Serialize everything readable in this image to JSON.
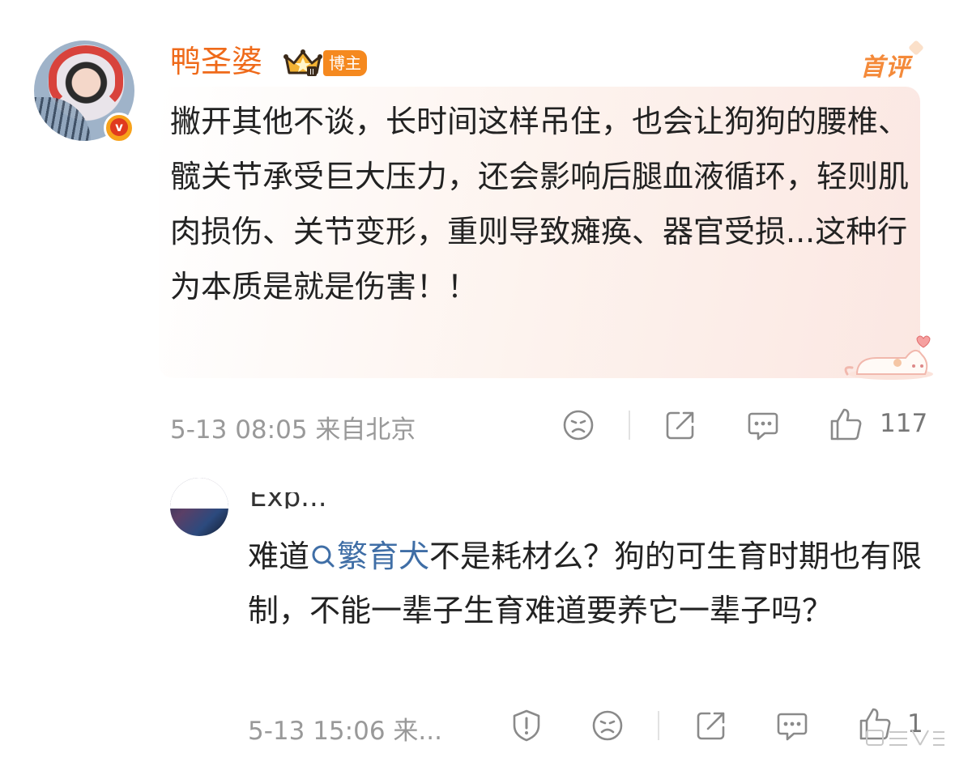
{
  "comment1": {
    "username": "鸭圣婆",
    "badge_label": "博主",
    "first_comment_label": "首评",
    "text": "撇开其他不谈，长时间这样吊住，也会让狗狗的腰椎、髋关节承受巨大压力，还会影响后腿血液循环，轻则肌肉损伤、关节变形，重则导致瘫痪、器官受损...这种行为本质是就是伤害！！",
    "meta": "5-13 08:05 来自北京",
    "like_count": "117",
    "icons": [
      "sad-face-icon",
      "share-icon",
      "comment-icon",
      "thumbs-up-icon"
    ]
  },
  "comment2": {
    "username_partial": "Exp...",
    "text_before": "难道",
    "topic": "繁育犬",
    "text_after": "不是耗材么？狗的可生育时期也有限制，不能一辈子生育难道要养它一辈子吗？",
    "meta": "5-13 15:06 来...",
    "like_count": "1",
    "icons": [
      "report-icon",
      "sad-face-icon",
      "share-icon",
      "comment-icon",
      "thumbs-up-icon"
    ]
  },
  "colors": {
    "username": "#ef6a1a",
    "blogger_badge": "#f5891f",
    "link": "#3f6ea6",
    "meta": "#999999"
  }
}
